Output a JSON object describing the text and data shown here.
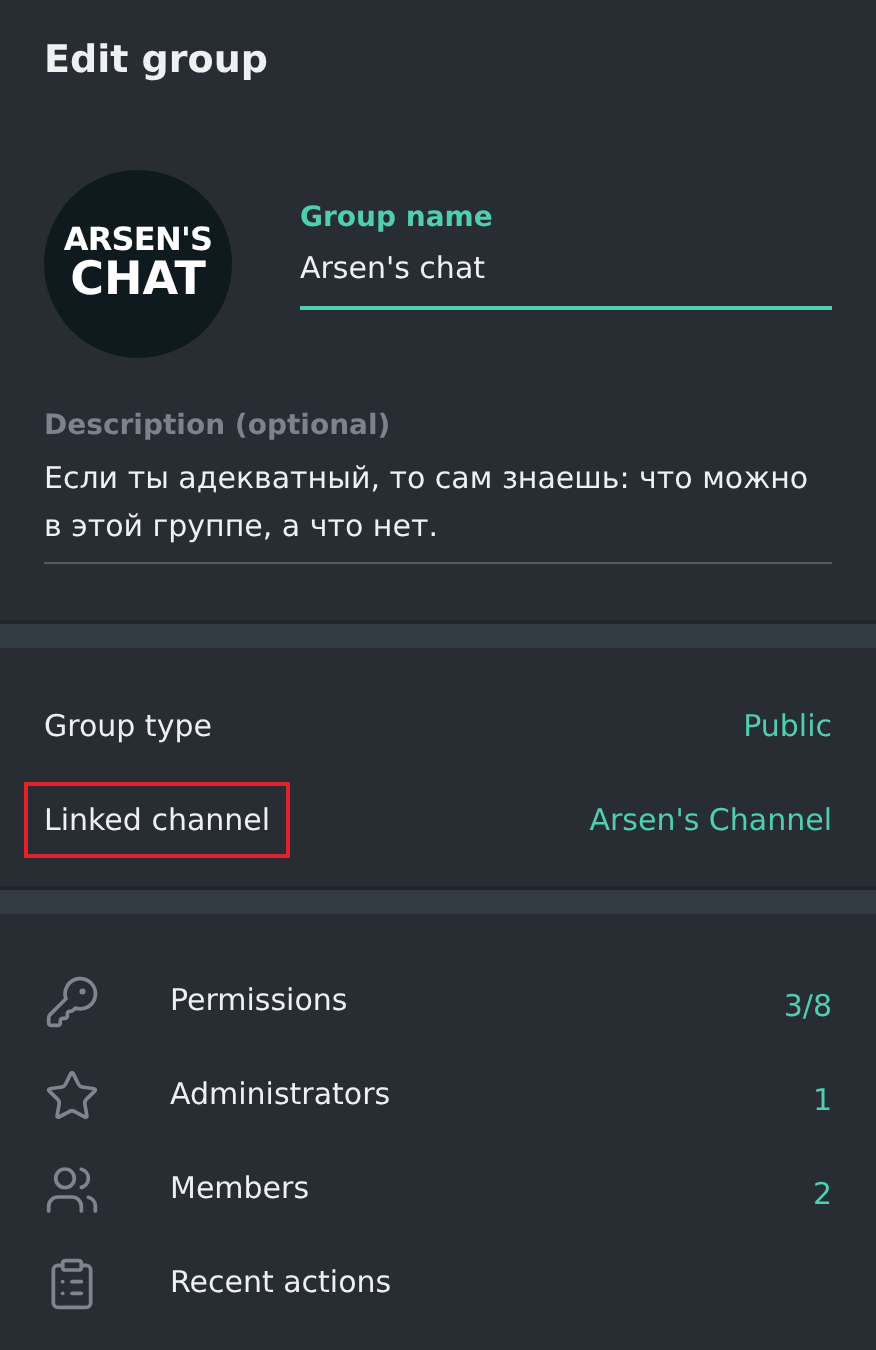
{
  "window": {
    "title": "Edit group"
  },
  "avatar": {
    "line_1": "ARSEN'S",
    "line_2": "CHAT"
  },
  "group_name": {
    "label": "Group name",
    "value": "Arsen's chat",
    "focused": true
  },
  "description": {
    "label": "Description (optional)",
    "value": "Если ты адекватный, то сам знаешь: что можно в этой группе, а что нет."
  },
  "settings": [
    {
      "label": "Group type",
      "value": "Public",
      "highlighted": false
    },
    {
      "label": "Linked channel",
      "value": "Arsen's Channel",
      "highlighted": true
    }
  ],
  "menu": [
    {
      "label": "Permissions",
      "count": "3/8"
    },
    {
      "label": "Administrators",
      "count": "1"
    },
    {
      "label": "Members",
      "count": "2"
    },
    {
      "label": "Recent actions"
    }
  ]
}
